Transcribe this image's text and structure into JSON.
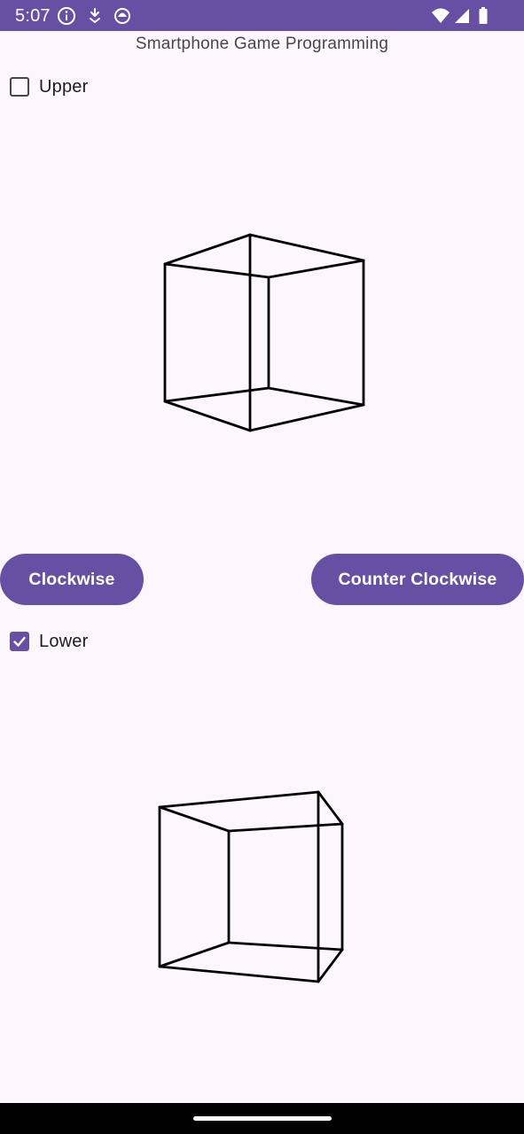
{
  "status_bar": {
    "time": "5:07",
    "left_icons": [
      "info-icon",
      "download-icon",
      "app-icon"
    ],
    "right_icons": [
      "wifi-icon",
      "signal-icon",
      "battery-icon"
    ],
    "color": "#6750a4"
  },
  "app": {
    "title": "Smartphone Game Programming"
  },
  "upper": {
    "checkbox_label": "Upper",
    "checked": false
  },
  "buttons": {
    "clockwise_label": "Clockwise",
    "counter_clockwise_label": "Counter Clockwise",
    "color": "#6750a4"
  },
  "lower": {
    "checkbox_label": "Lower",
    "checked": true
  },
  "nav_bar": {
    "color": "#000000"
  }
}
